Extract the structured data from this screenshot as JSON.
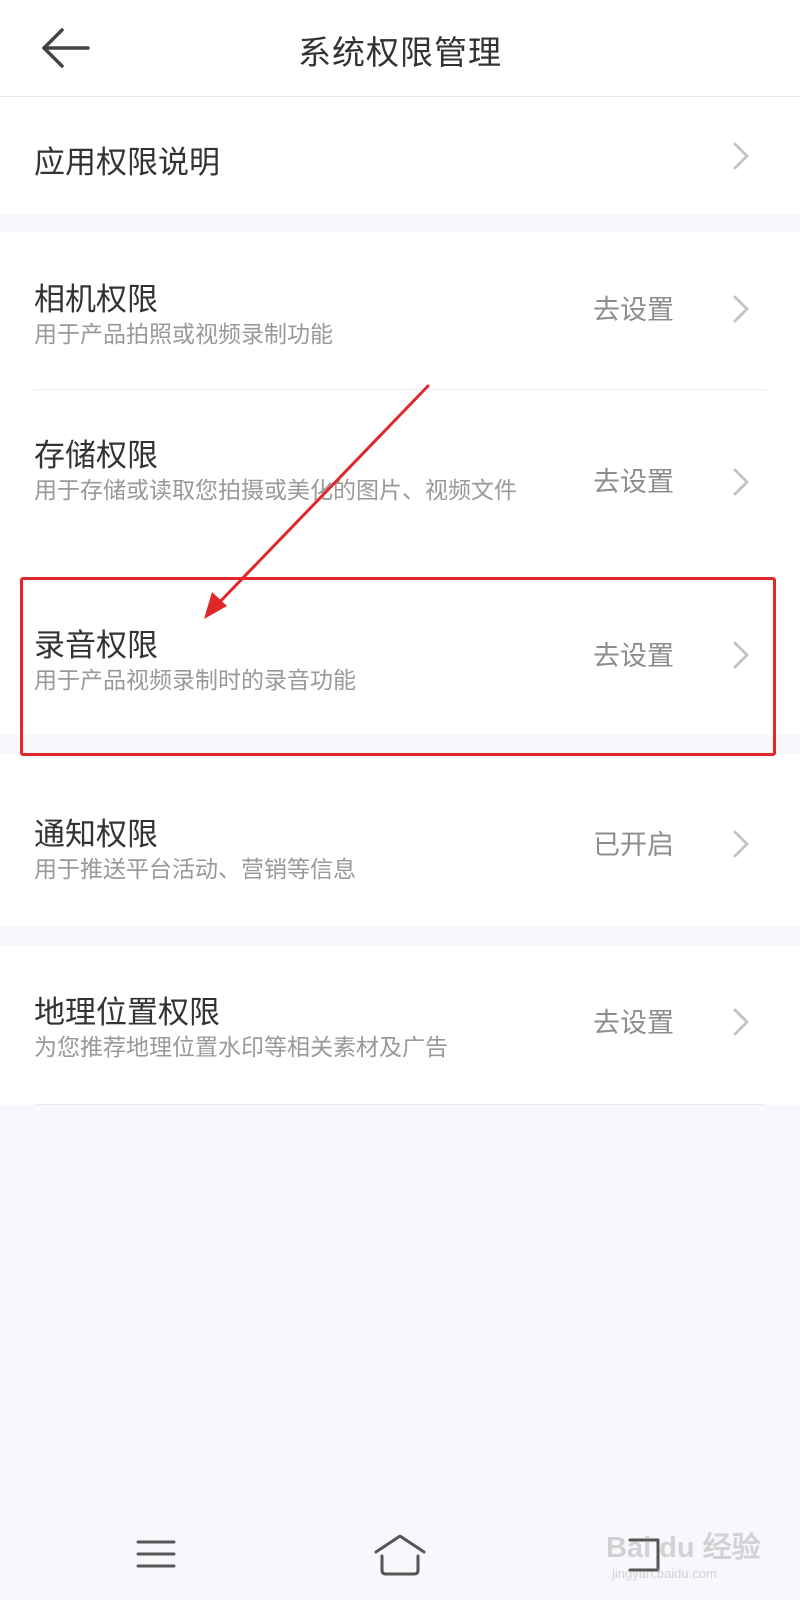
{
  "header": {
    "title": "系统权限管理",
    "back_icon": "arrow-left-icon"
  },
  "intro": {
    "label": "应用权限说明"
  },
  "permissions": [
    {
      "title": "相机权限",
      "desc": "用于产品拍照或视频录制功能",
      "action": "去设置"
    },
    {
      "title": "存储权限",
      "desc": "用于存储或读取您拍摄或美化的图片、视频文件",
      "action": "去设置"
    },
    {
      "title": "录音权限",
      "desc": "用于产品视频录制时的录音功能",
      "action": "去设置"
    },
    {
      "title": "通知权限",
      "desc": "用于推送平台活动、营销等信息",
      "action": "已开启"
    },
    {
      "title": "地理位置权限",
      "desc": "为您推荐地理位置水印等相关素材及广告",
      "action": "去设置"
    }
  ],
  "annotation": {
    "color": "#e0282a"
  },
  "navbar": {
    "menu_icon": "menu-icon",
    "home_icon": "home-icon",
    "back_icon": "back-nav-icon"
  },
  "watermark": {
    "text": "Bai du 经验",
    "sub": "jingyan.baidu.com"
  },
  "colors": {
    "background": "#f8f8fc",
    "title_text": "#333333",
    "desc_text": "#999999",
    "action_text": "#8d8d8d",
    "chevron": "#c4c4c4"
  }
}
